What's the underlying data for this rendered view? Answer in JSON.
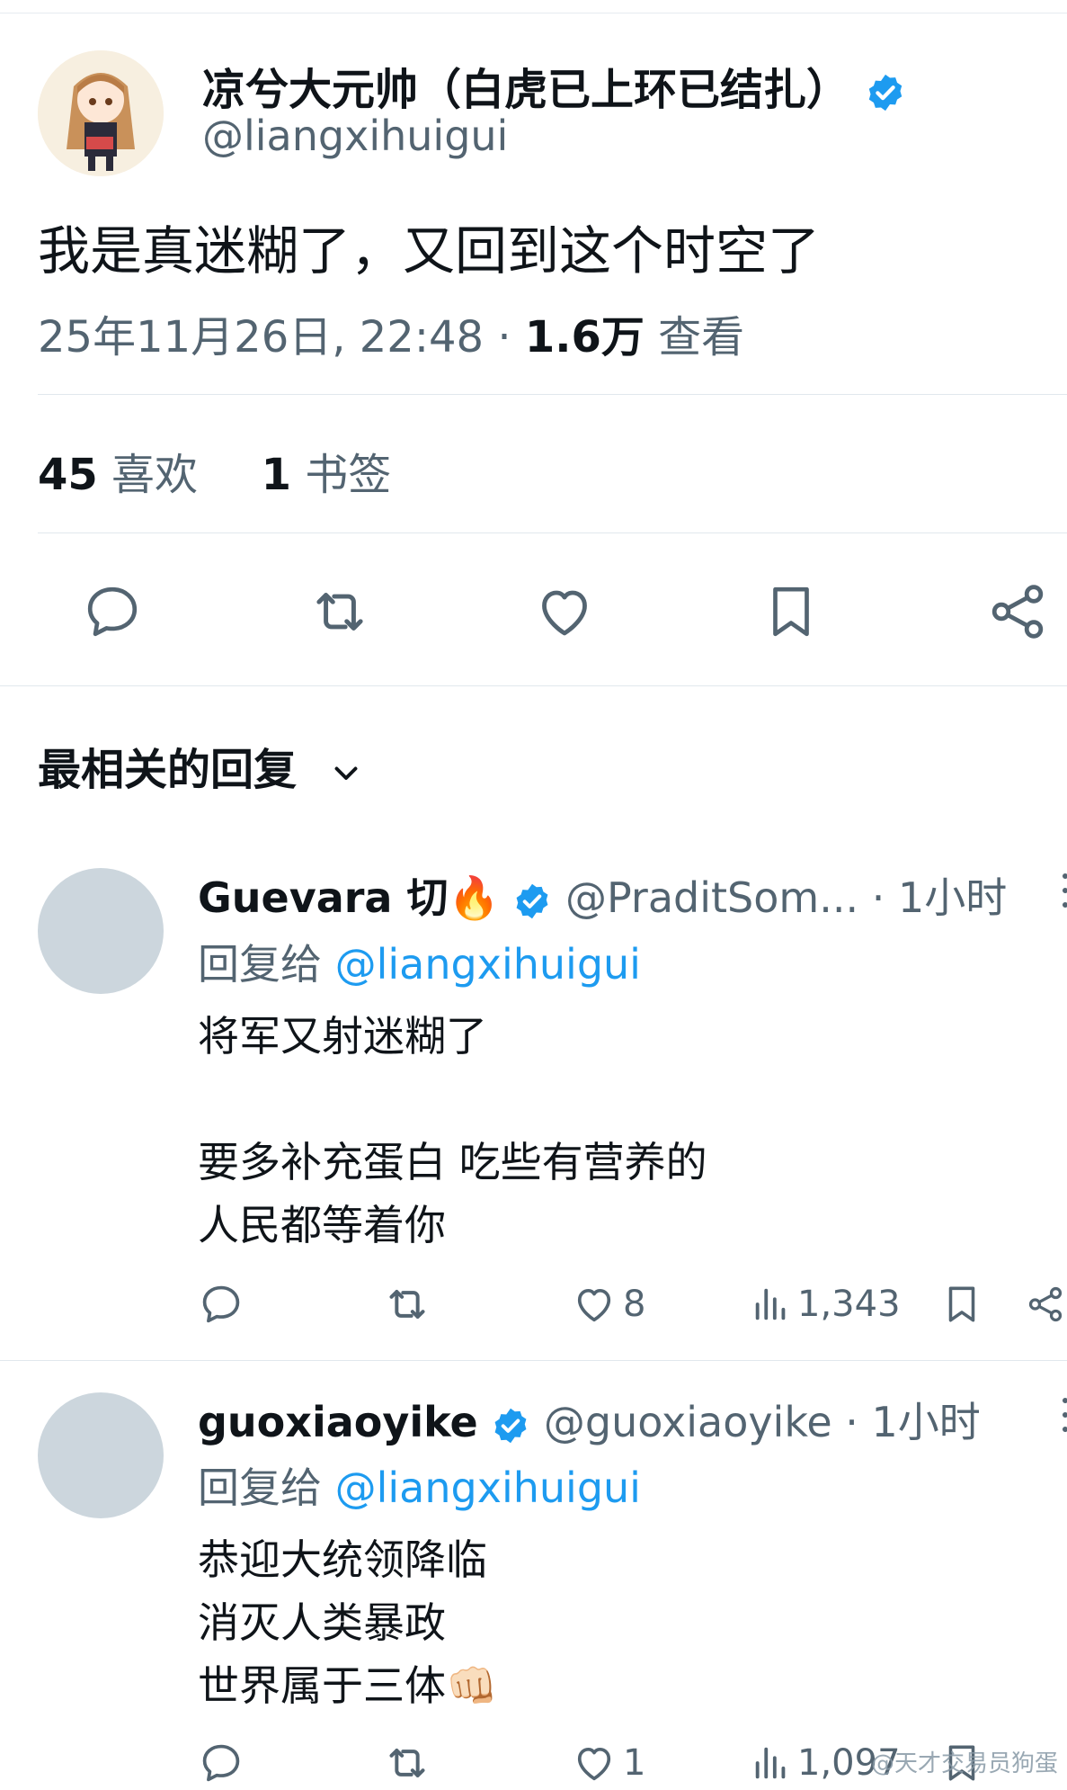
{
  "tweet": {
    "author_name": "凉兮大元帅（白虎已上环已结扎）",
    "author_handle": "@liangxihuigui",
    "avatar_label": "凉兮",
    "text": "我是真迷糊了，又回到这个时空了",
    "datetime": "25年11月26日, 22:48",
    "separator": " · ",
    "views_count": "1.6万",
    "views_label": " 查看",
    "likes_count": "45",
    "likes_label": " 喜欢",
    "bookmarks_count": "1",
    "bookmarks_label": " 书签"
  },
  "actions_icons": [
    "reply-icon",
    "retweet-icon",
    "like-icon",
    "bookmark-icon",
    "share-icon"
  ],
  "sort_label": "最相关的回复",
  "colors": {
    "accent": "#1d9bf0",
    "muted": "#536471",
    "text": "#0f1419",
    "divider": "#e1e8ed"
  },
  "replies": [
    {
      "name": "Guevara 切🔥",
      "handle": "@PraditSom...",
      "time": " · 1小时",
      "reply_to_label": "回复给 ",
      "reply_to_handle": "@liangxihuigui",
      "lines": [
        "将军又射迷糊了",
        "",
        "要多补充蛋白 吃些有营养的",
        "人民都等着你"
      ],
      "likes": "8",
      "views": "1,343"
    },
    {
      "name": "guoxiaoyike",
      "handle": "@guoxiaoyike",
      "time": " · 1小时",
      "reply_to_label": "回复给 ",
      "reply_to_handle": "@liangxihuigui",
      "lines": [
        "恭迎大统领降临",
        "消灭人类暴政",
        "世界属于三体👊🏻"
      ],
      "likes": "1",
      "views": "1,097"
    }
  ],
  "watermark": "@天才交易员狗蛋"
}
